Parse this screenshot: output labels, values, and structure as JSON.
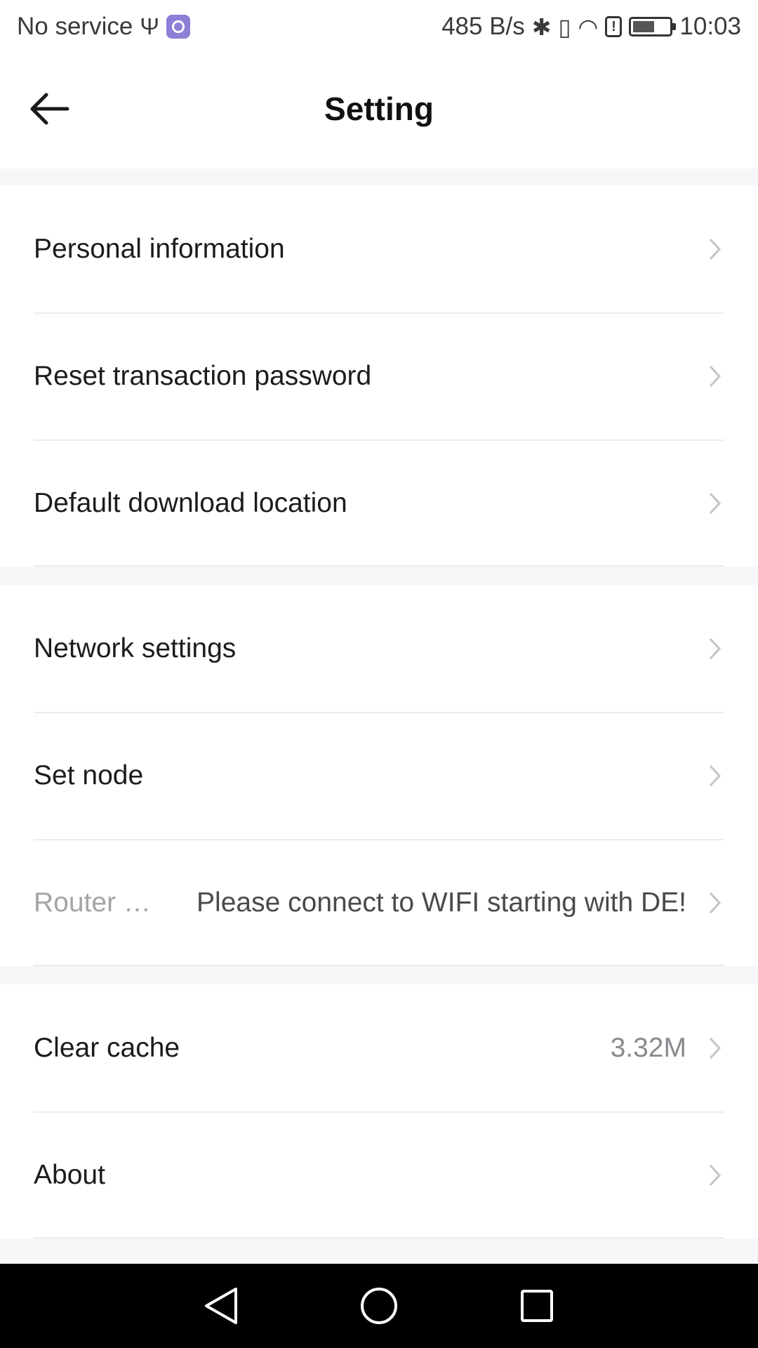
{
  "status_bar": {
    "carrier": "No service",
    "usb_glyph": "Ψ",
    "network_speed": "485 B/s",
    "bluetooth_glyph": "✱",
    "vibrate_glyph": "▯",
    "wifi_glyph": "◠",
    "sim_alert_glyph": "!",
    "time": "10:03",
    "icons": [
      "usb-icon",
      "app-notification-icon",
      "bluetooth-icon",
      "vibrate-icon",
      "wifi-icon",
      "sim-alert-icon",
      "battery-icon"
    ]
  },
  "header": {
    "title": "Setting",
    "back_icon": "arrow-left-icon"
  },
  "sections": [
    {
      "items": [
        {
          "label": "Personal information",
          "value": ""
        },
        {
          "label": "Reset transaction password",
          "value": ""
        },
        {
          "label": "Default download location",
          "value": ""
        }
      ]
    },
    {
      "items": [
        {
          "label": "Network settings",
          "value": ""
        },
        {
          "label": "Set node",
          "value": ""
        },
        {
          "label": "Router …",
          "value": "Please connect to WIFI starting with DE!"
        }
      ]
    },
    {
      "items": [
        {
          "label": "Clear cache",
          "value": "3.32M"
        },
        {
          "label": "About",
          "value": ""
        }
      ]
    }
  ],
  "nav_bar": {
    "icons": [
      "nav-back-icon",
      "nav-home-icon",
      "nav-recents-icon"
    ]
  },
  "colors": {
    "background": "#f5f6f8",
    "surface": "#ffffff",
    "divider": "#ececec",
    "muted_text": "#a3a3a8",
    "chevron": "#c4c4c8",
    "nav_bar": "#000000"
  }
}
